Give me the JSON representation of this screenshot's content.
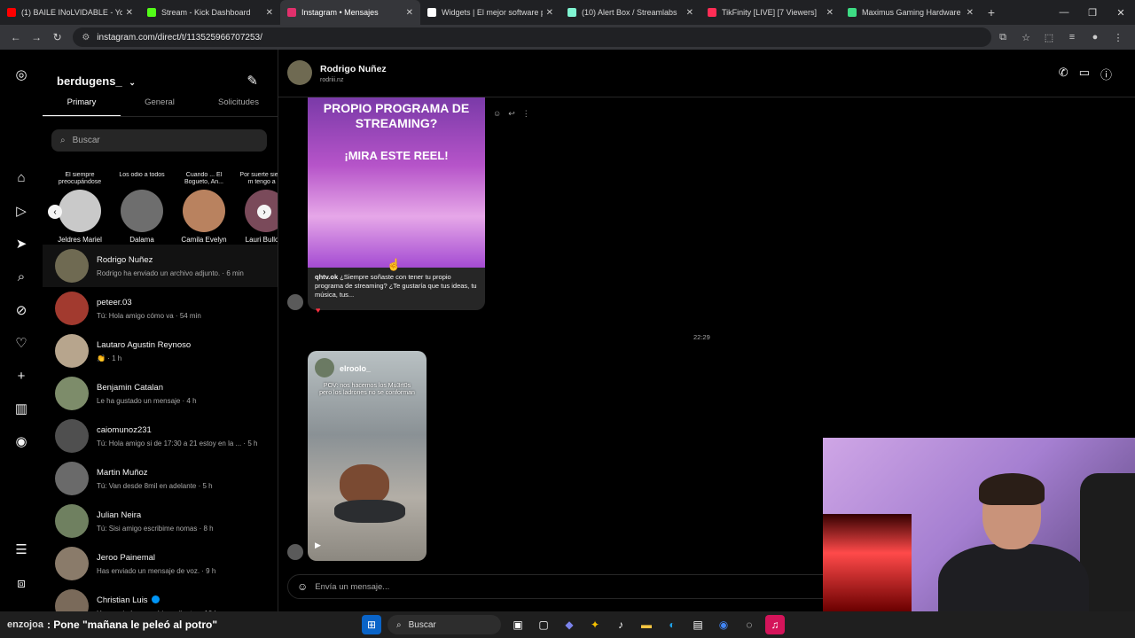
{
  "browser": {
    "tabs": [
      {
        "title": "(1) BAILE INoLVIDABLE - Yo",
        "color": "#ff0000",
        "active": false
      },
      {
        "title": "Stream - Kick Dashboard",
        "color": "#53fc18",
        "active": false
      },
      {
        "title": "Instagram • Mensajes",
        "color": "#e1306c",
        "active": true
      },
      {
        "title": "Widgets | El mejor software pa",
        "color": "#ffffff",
        "active": false
      },
      {
        "title": "(10) Alert Box / Streamlabs",
        "color": "#80f5d2",
        "active": false
      },
      {
        "title": "TikFinity [LIVE] [7 Viewers]",
        "color": "#ff2d55",
        "active": false
      },
      {
        "title": "Maximus Gaming Hardware - P",
        "color": "#3ddc84",
        "active": false
      }
    ],
    "url": "instagram.com/direct/t/113525966707253/"
  },
  "inbox": {
    "username": "berdugens_",
    "tabs": [
      "Primary",
      "General",
      "Solicitudes"
    ],
    "search_placeholder": "Buscar",
    "notes": [
      {
        "bubble": "El siempre preocupándose",
        "name": "Jeldres Mariel",
        "color": "#c9c9c9"
      },
      {
        "bubble": "Los odio a todos",
        "name": "Dalama",
        "color": "#6e6e6e"
      },
      {
        "bubble": "Cuando ... El Bogueto, An...",
        "name": "Camila Evelyn",
        "color": "#b9825f"
      },
      {
        "bubble": "Por suerte siempre m tengo a mí",
        "name": "Lauri Bullone",
        "color": "#7a4a5a"
      }
    ],
    "conversations": [
      {
        "name": "Rodrigo Nuñez",
        "preview": "Rodrigo ha enviado un archivo adjunto. · 6 min",
        "color": "#6f6a52",
        "selected": true,
        "verified": false
      },
      {
        "name": "peteer.03",
        "preview": "Tú: Hola amigo cómo va · 54 min",
        "color": "#a23a2f",
        "selected": false,
        "verified": false
      },
      {
        "name": "Lautaro Agustin Reynoso",
        "preview": "👏 · 1 h",
        "color": "#b7a58d",
        "selected": false,
        "verified": false
      },
      {
        "name": "Benjamin Catalan",
        "preview": "Le ha gustado un mensaje · 4 h",
        "color": "#7d8c6a",
        "selected": false,
        "verified": false
      },
      {
        "name": "caiomunoz231",
        "preview": "Tú: Hola amigo si de 17:30 a 21 estoy en la ... · 5 h",
        "color": "#4f4f4f",
        "selected": false,
        "verified": false
      },
      {
        "name": "Martin Muñoz",
        "preview": "Tú: Van desde 8mil en adelante · 5 h",
        "color": "#6a6a6a",
        "selected": false,
        "verified": false
      },
      {
        "name": "Julian Neira",
        "preview": "Tú: Sisi amigo escribime nomas · 8 h",
        "color": "#6f8060",
        "selected": false,
        "verified": false
      },
      {
        "name": "Jeroo Painemal",
        "preview": "Has enviado un mensaje de voz. · 9 h",
        "color": "#8a7b6a",
        "selected": false,
        "verified": false
      },
      {
        "name": "Christian Luis",
        "preview": "Has enviado un archivo adjunto. · 10 h",
        "color": "#7a6a5a",
        "selected": false,
        "verified": true
      }
    ]
  },
  "chat": {
    "name": "Rodrigo Nuñez",
    "username": "rodriii.nz",
    "reel": {
      "headline": "PROPIO PROGRAMA DE STREAMING?",
      "sub": "¡MIRA ESTE REEL!",
      "caption_user": "qhtv.ok",
      "caption": "¿Siempre soñaste con tener tu propio programa de streaming? ¿Te gustaría que tus ideas, tu música, tus..."
    },
    "timestamp": "22:29",
    "reel2": {
      "user": "elroolo_",
      "caption": "POV: nos hacemos los Mu3rt0s pero los ladrones no se conforman"
    },
    "composer_placeholder": "Envía un mensaje..."
  },
  "taskbar": {
    "ticker_user": "enzojoa",
    "ticker_text": ": Pone \"mañana le peleó al potro\"",
    "search": "Buscar"
  }
}
